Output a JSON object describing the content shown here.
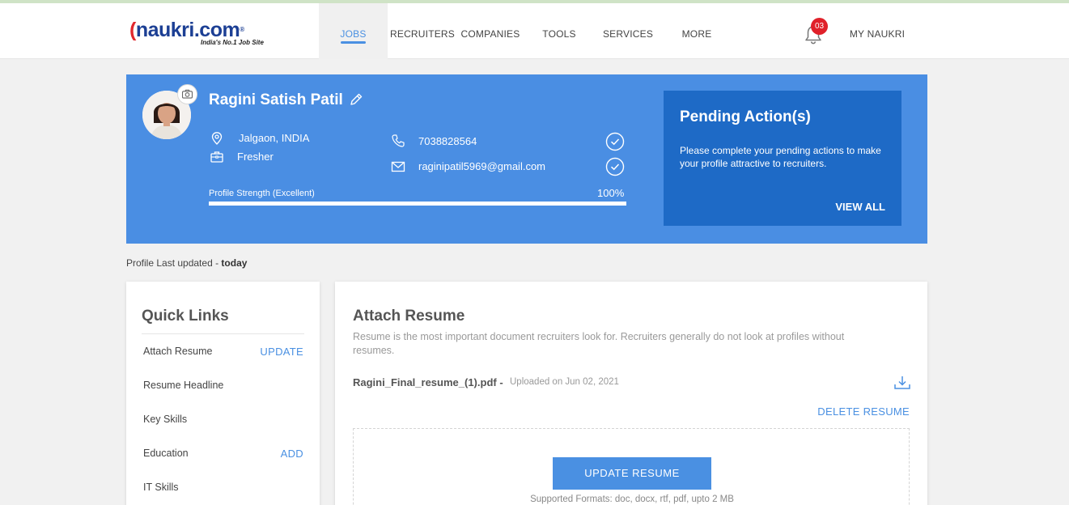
{
  "header": {
    "logo_text": "naukri.com",
    "logo_tagline": "India's No.1 Job Site",
    "nav": [
      {
        "label": "JOBS",
        "active": true
      },
      {
        "label": "RECRUITERS",
        "active": false
      },
      {
        "label": "COMPANIES",
        "active": false
      },
      {
        "label": "TOOLS",
        "active": false
      },
      {
        "label": "SERVICES",
        "active": false
      },
      {
        "label": "MORE",
        "active": false
      }
    ],
    "notification_count": "03",
    "my_naukri": "MY NAUKRI"
  },
  "profile": {
    "name": "Ragini Satish Patil",
    "location": "Jalgaon, INDIA",
    "experience": "Fresher",
    "phone": "7038828564",
    "email": "raginipatil5969@gmail.com",
    "strength_label": "Profile Strength (Excellent)",
    "strength_percent": "100%",
    "strength_value": 100
  },
  "pending": {
    "title": "Pending Action(s)",
    "text": "Please complete your pending actions to make your profile attractive to recruiters.",
    "view_all": "VIEW ALL"
  },
  "last_updated": {
    "prefix": "Profile Last updated - ",
    "value": "today"
  },
  "quick_links": {
    "title": "Quick Links",
    "items": [
      {
        "label": "Attach Resume",
        "action": "UPDATE"
      },
      {
        "label": "Resume Headline",
        "action": ""
      },
      {
        "label": "Key Skills",
        "action": ""
      },
      {
        "label": "Education",
        "action": "ADD"
      },
      {
        "label": "IT Skills",
        "action": ""
      }
    ]
  },
  "attach_resume": {
    "title": "Attach Resume",
    "description": "Resume is the most important document recruiters look for. Recruiters generally do not look at profiles without resumes.",
    "file_name": "Ragini_Final_resume_(1).pdf -",
    "uploaded": "Uploaded on Jun 02, 2021",
    "delete_label": "DELETE RESUME",
    "update_label": "UPDATE RESUME",
    "formats": "Supported Formats: doc, docx, rtf, pdf, upto 2 MB"
  },
  "colors": {
    "accent": "#4a90e2",
    "profile_bg": "#4a8ee3",
    "pending_bg": "#1e6ac6",
    "badge": "#e0212a"
  },
  "icons": [
    "camera-icon",
    "edit-pencil-icon",
    "location-pin-icon",
    "briefcase-icon",
    "phone-icon",
    "mail-icon",
    "check-circle-icon",
    "bell-icon",
    "download-icon"
  ]
}
